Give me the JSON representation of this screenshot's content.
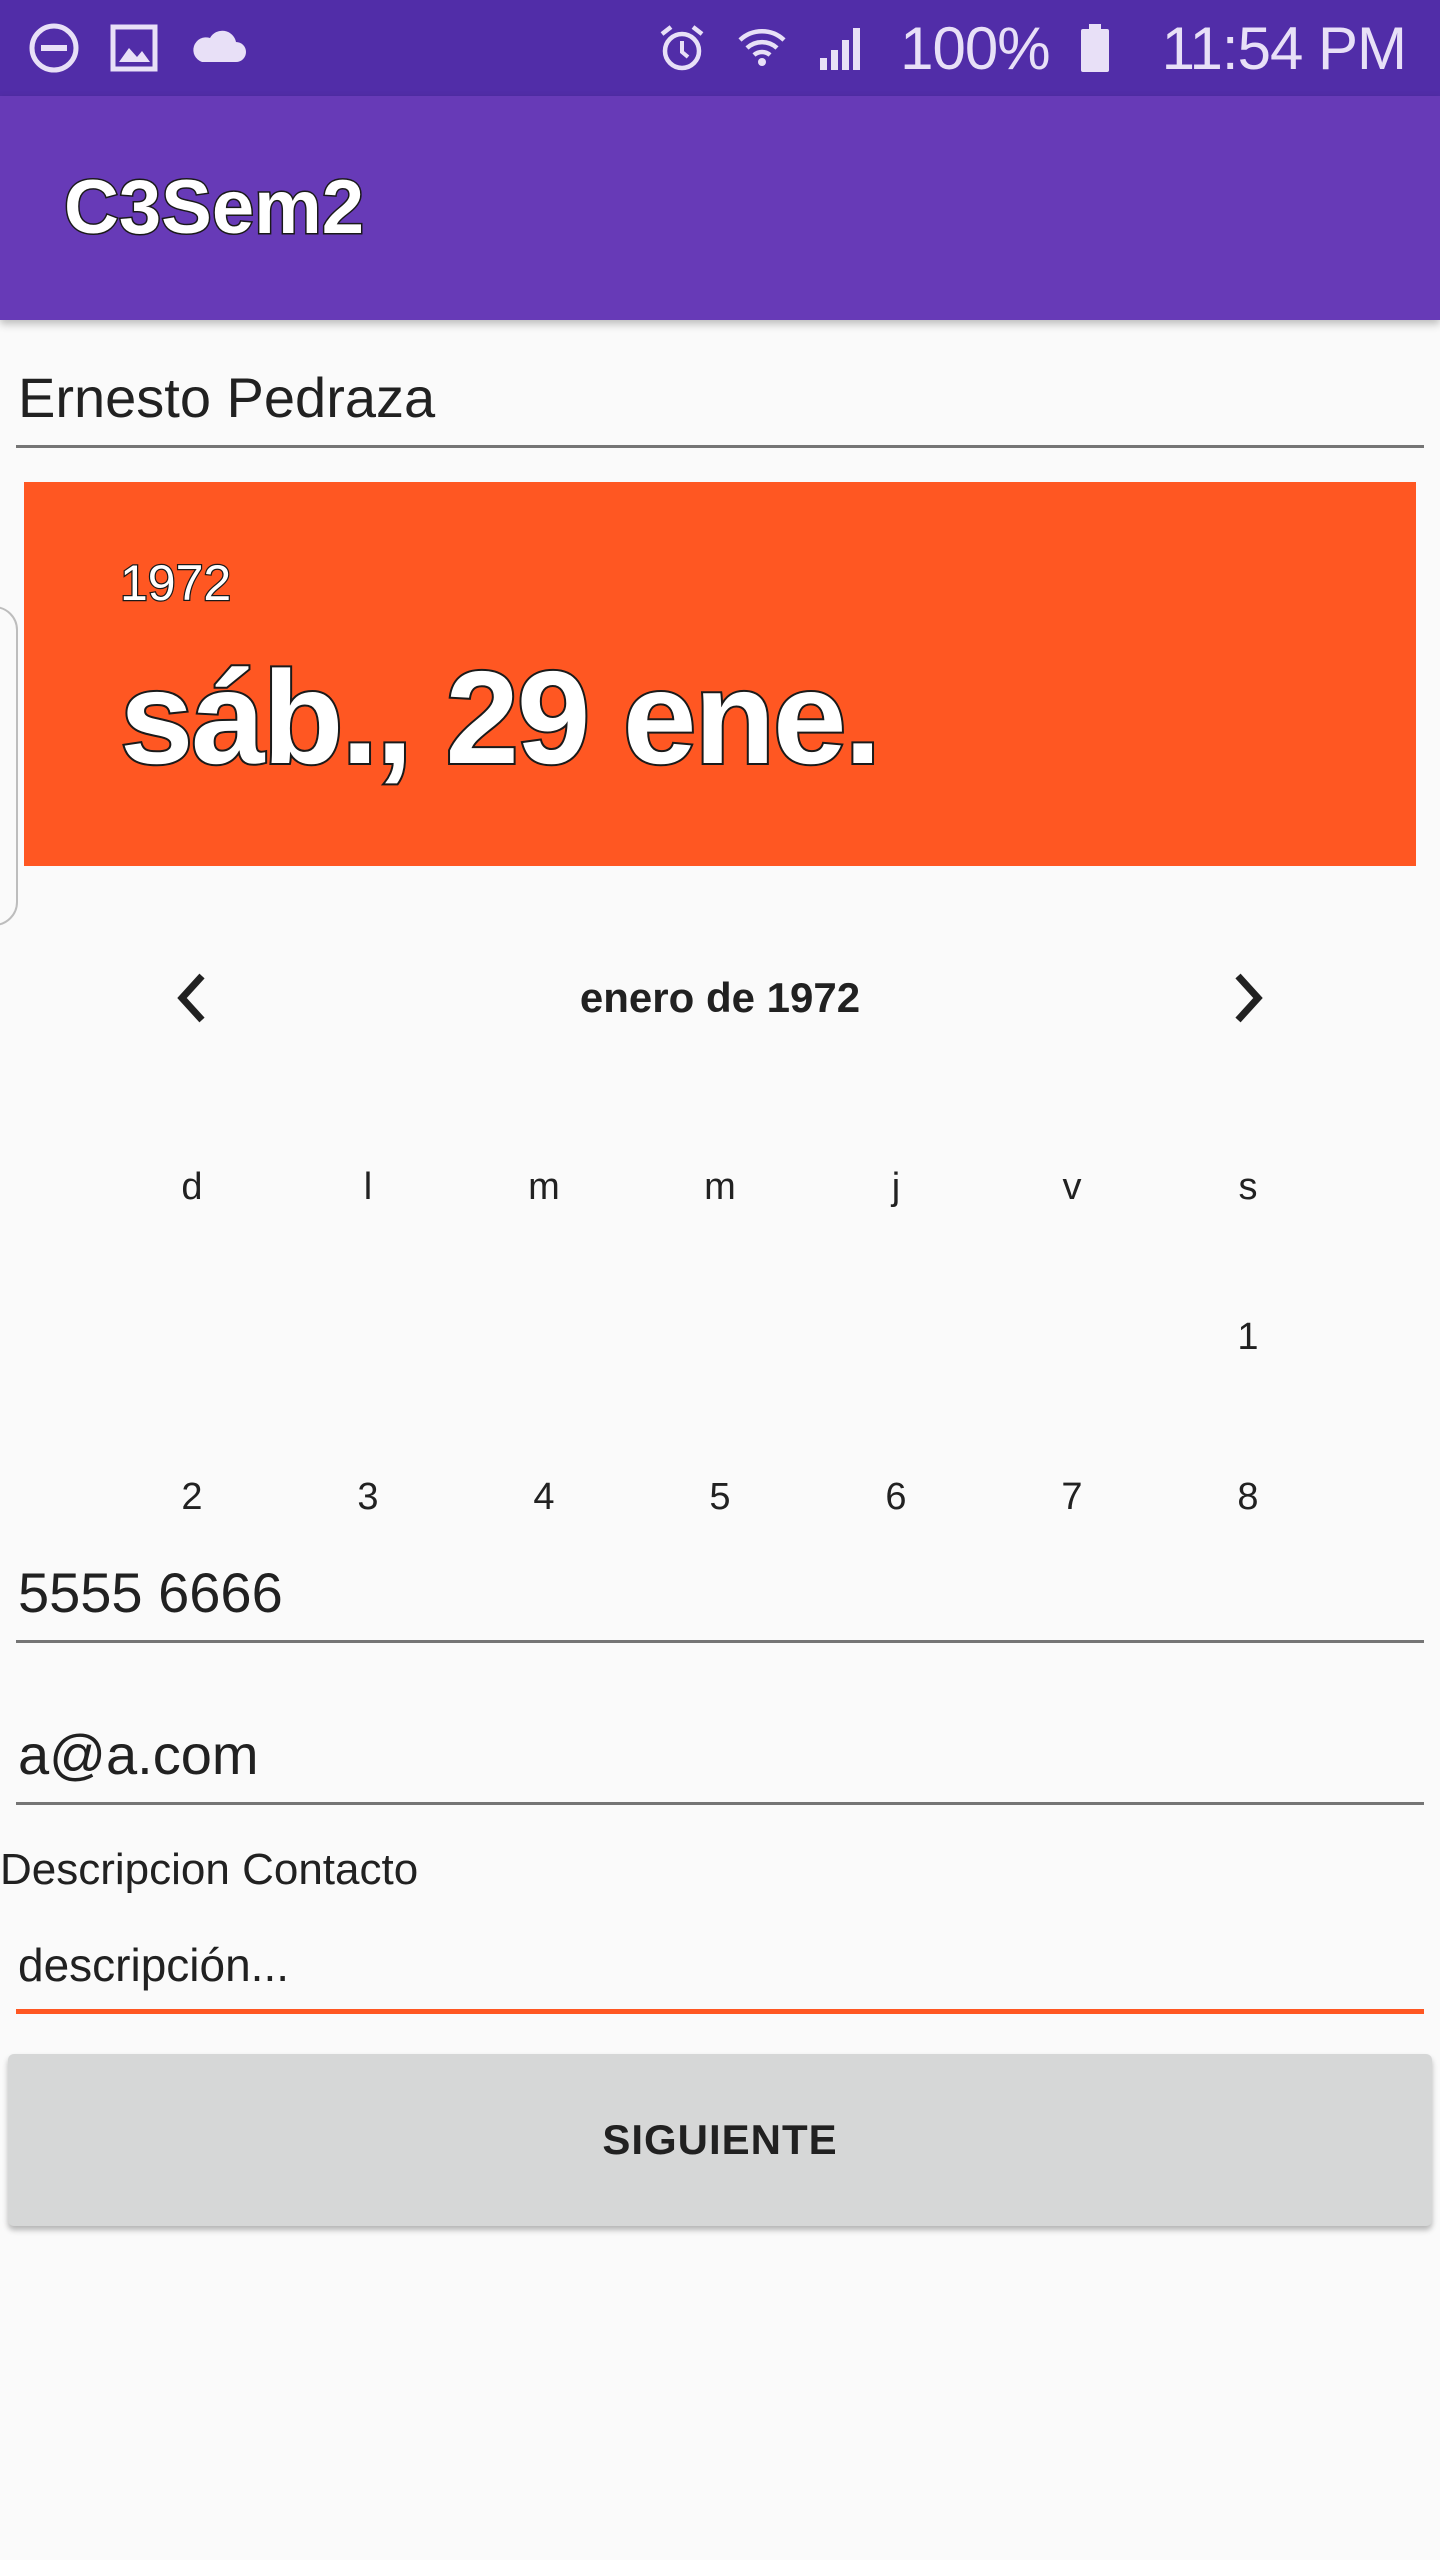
{
  "status_bar": {
    "left_icons": [
      "do-not-disturb-icon",
      "gallery-icon",
      "cloud-icon"
    ],
    "right_icons": [
      "alarm-icon",
      "wifi-icon",
      "signal-icon",
      "battery-icon"
    ],
    "battery": "100%",
    "time": "11:54 PM"
  },
  "app_bar": {
    "title": "C3Sem2"
  },
  "form": {
    "name_value": "Ernesto Pedraza",
    "phone_value": "5555 6666",
    "email_value": "a@a.com",
    "description_label": "Descripcion Contacto",
    "description_value": "descripción..."
  },
  "date_picker": {
    "header_year": "1972",
    "header_date": "sáb., 29 ene.",
    "month_label": "enero de 1972",
    "weekdays": [
      "d",
      "l",
      "m",
      "m",
      "j",
      "v",
      "s"
    ],
    "days": [
      "1",
      "2",
      "3",
      "4",
      "5",
      "6",
      "7",
      "8"
    ]
  },
  "actions": {
    "next_label": "SIGUIENTE"
  },
  "colors": {
    "status_bar": "#512da8",
    "app_bar": "#673ab7",
    "accent": "#ff5722",
    "button_bg": "#d6d7d7"
  }
}
